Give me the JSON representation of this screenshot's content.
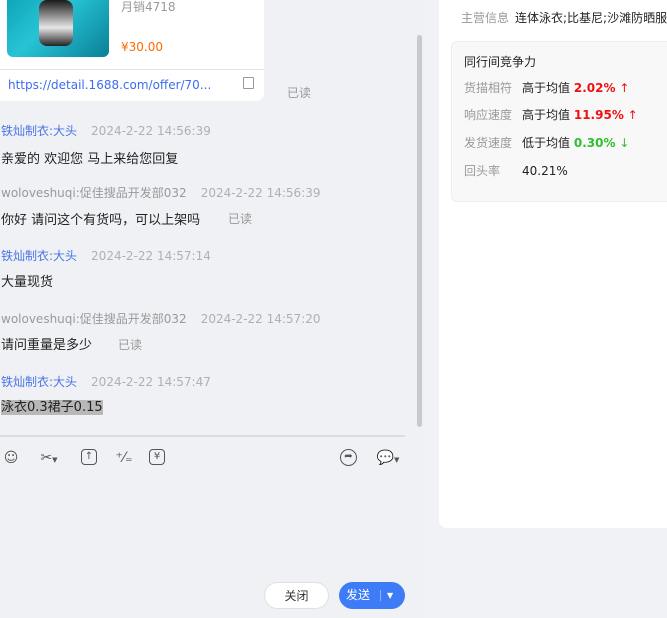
{
  "product": {
    "sales": "月销4718",
    "price": "¥30.00",
    "link": "https://detail.1688.com/offer/70...",
    "read": "已读"
  },
  "messages": [
    {
      "sender": "铁灿制衣:大头",
      "time": "2024-2-22 14:56:39",
      "text": "亲爱的 欢迎您 马上来给您回复",
      "read": ""
    },
    {
      "sender": "woloveshuqi:促佳搜品开发部032",
      "time": "2024-2-22 14:56:39",
      "text": "你好 请问这个有货吗，可以上架吗",
      "read": "已读"
    },
    {
      "sender": "铁灿制衣:大头",
      "time": "2024-2-22 14:57:14",
      "text": "大量现货",
      "read": ""
    },
    {
      "sender": "woloveshuqi:促佳搜品开发部032",
      "time": "2024-2-22 14:57:20",
      "text": "请问重量是多少",
      "read": "已读"
    },
    {
      "sender": "铁灿制衣:大头",
      "time": "2024-2-22 14:57:47",
      "text": "泳衣0.3裙子0.15",
      "read": ""
    }
  ],
  "buttons": {
    "close": "关闭",
    "send": "发送"
  },
  "shop": {
    "main_label": "主营信息",
    "main_value": "连体泳衣;比基尼;沙滩防晒服",
    "comp_title": "同行间竞争力",
    "rows": [
      {
        "label": "货描相符",
        "desc": "高于均值",
        "value": "2.02%",
        "arrow": "↑"
      },
      {
        "label": "响应速度",
        "desc": "高于均值",
        "value": "11.95%",
        "arrow": "↑"
      },
      {
        "label": "发货速度",
        "desc": "低于均值",
        "value": "0.30%",
        "arrow": "↓"
      },
      {
        "label": "回头率",
        "desc": "40.21%",
        "value": "",
        "arrow": ""
      }
    ]
  },
  "colors": {
    "accent": "#3d7cf6",
    "up": "#f01010",
    "down": "#2fbf2f",
    "price": "#ff6a00"
  }
}
